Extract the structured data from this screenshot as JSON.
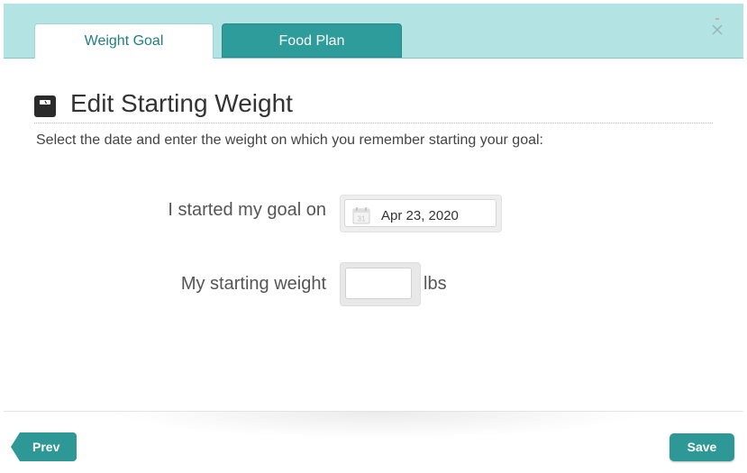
{
  "tabs": [
    {
      "label": "Weight Goal",
      "active": true
    },
    {
      "label": "Food Plan",
      "active": false
    }
  ],
  "close_icon": "close-icon",
  "header": {
    "icon": "scale-icon",
    "title": "Edit Starting Weight"
  },
  "subtitle": "Select the date and enter the weight on which you remember starting your goal:",
  "form": {
    "start_label": "I started my goal on",
    "calendar_icon_text": "31",
    "start_date": "Apr 23, 2020",
    "weight_label": "My starting weight",
    "weight_value": "",
    "weight_unit": "lbs"
  },
  "footer": {
    "prev_label": "Prev",
    "save_label": "Save"
  },
  "colors": {
    "topbar": "#b4e3e4",
    "tab_active_text": "#1f7f84",
    "tab_inactive_bg": "#2e9c9b",
    "button": "#2e9896"
  }
}
